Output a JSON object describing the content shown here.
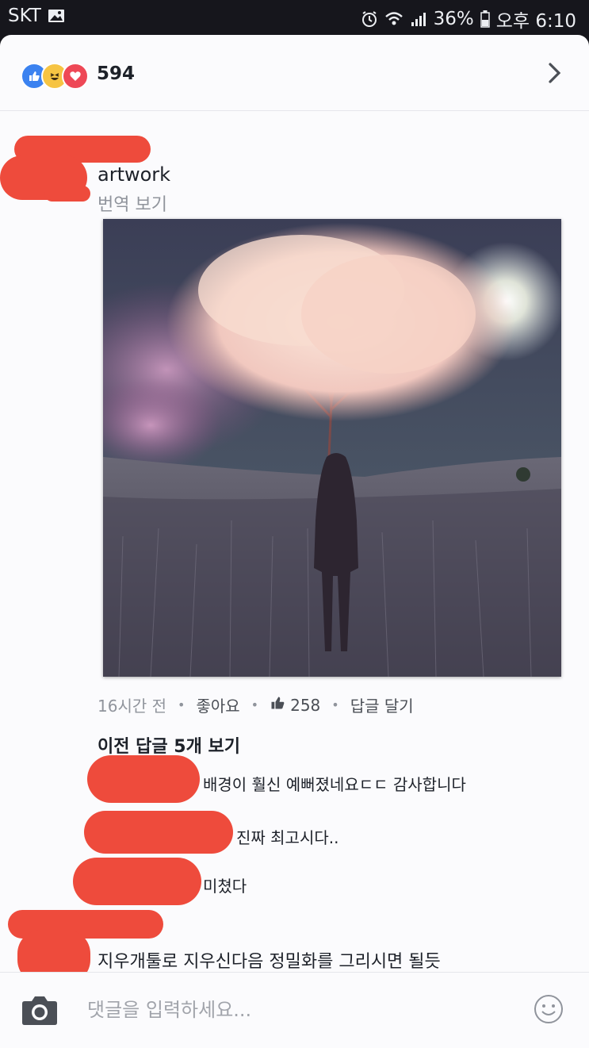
{
  "status_bar": {
    "carrier": "SKT",
    "battery": "36%",
    "time": "오후 6:10"
  },
  "reactions": {
    "icons": [
      "like-icon",
      "haha-icon",
      "love-icon"
    ],
    "count": "594"
  },
  "post": {
    "title": "artwork",
    "translate_link": "번역 보기",
    "time_ago": "16시간 전",
    "like_label": "좋아요",
    "like_count": "258",
    "reply_label": "답글 달기",
    "view_previous": "이전 답글 5개 보기"
  },
  "replies": [
    {
      "text": "배경이 훨신 예뻐졌네요ㄷㄷ 감사합니다"
    },
    {
      "text": "진짜 최고시다.."
    },
    {
      "text": "미쳤다"
    },
    {
      "text": "지우개툴로 지우신다음 정밀화를 그리시면 될듯"
    }
  ],
  "composer": {
    "placeholder": "댓글을 입력하세요..."
  },
  "colors": {
    "like_blue": "#3b82f0",
    "haha_yellow": "#f6c443",
    "love_red": "#ee4856",
    "redaction": "#ee4b3c"
  }
}
